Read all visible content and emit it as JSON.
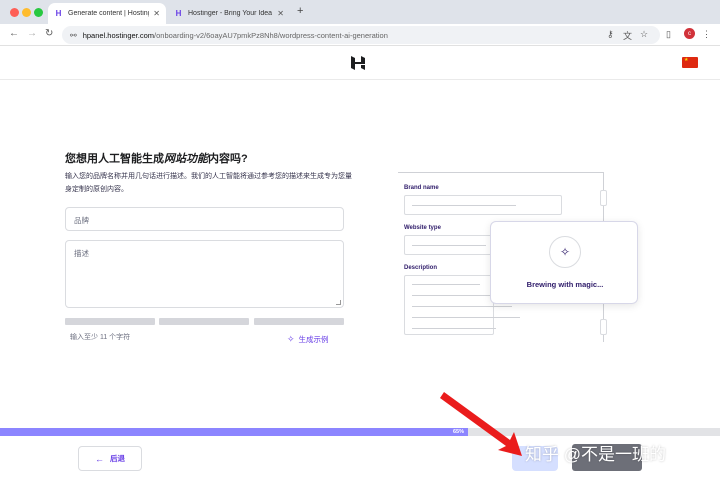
{
  "browser": {
    "tabs": [
      {
        "label": "Generate content | Hostinger",
        "active": true
      },
      {
        "label": "Hostinger - Bring Your Idea O",
        "active": false
      }
    ],
    "url_host": "hpanel.hostinger.com",
    "url_path": "/onboarding-v2/6oayAU7pmkPz8Nh8/wordpress-content-ai-generation",
    "profile_initial": "c"
  },
  "form": {
    "title_part1": "您想用人工智能生成",
    "title_em": "网站功能",
    "title_part2": "内容吗?",
    "description": "输入您的品牌名称并用几句话进行描述。我们的人工智能将通过参考您的描述来生成专为您量身定制的原创内容。",
    "brand_placeholder": "品牌",
    "desc_placeholder": "描述",
    "hint": "输入至少 11 个字符",
    "examples_label": "生成示例"
  },
  "illustration": {
    "brand_label": "Brand name",
    "type_label": "Website type",
    "description_label": "Description",
    "card_text": "Brewing with magic..."
  },
  "progress": {
    "value": 0.65,
    "label": "65%"
  },
  "footer": {
    "back_label": "后退"
  },
  "watermark": "知乎 @不是一班的",
  "colors": {
    "accent": "#673de6",
    "progress": "#8c85ff"
  }
}
